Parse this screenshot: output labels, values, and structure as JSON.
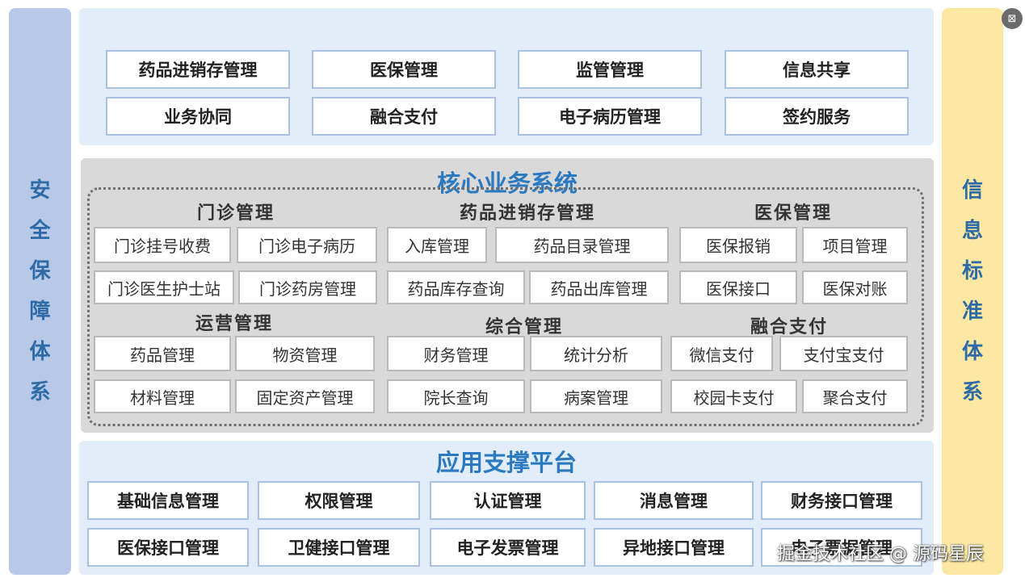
{
  "left_label": [
    "安",
    "全",
    "保",
    "障",
    "体",
    "系"
  ],
  "right_label": [
    "信",
    "息",
    "标",
    "准",
    "体",
    "系"
  ],
  "top_modules": [
    "药品进销存管理",
    "医保管理",
    "监管管理",
    "信息共享",
    "业务协同",
    "融合支付",
    "电子病历管理",
    "签约服务"
  ],
  "core": {
    "title": "核心业务系统",
    "groups": [
      {
        "name": "门诊管理",
        "items": [
          "门诊挂号收费",
          "门诊电子病历",
          "门诊医生护士站",
          "门诊药房管理"
        ]
      },
      {
        "name": "药品进销存管理",
        "items": [
          "入库管理",
          "药品目录管理",
          "药品库存查询",
          "药品出库管理"
        ]
      },
      {
        "name": "医保管理",
        "items": [
          "医保报销",
          "项目管理",
          "医保接口",
          "医保对账"
        ]
      },
      {
        "name": "运营管理",
        "items": [
          "药品管理",
          "物资管理",
          "材料管理",
          "固定资产管理"
        ]
      },
      {
        "name": "综合管理",
        "items": [
          "财务管理",
          "统计分析",
          "院长查询",
          "病案管理"
        ]
      },
      {
        "name": "融合支付",
        "items": [
          "微信支付",
          "支付宝支付",
          "校园卡支付",
          "聚合支付"
        ]
      }
    ]
  },
  "platform": {
    "title": "应用支撑平台",
    "items": [
      "基础信息管理",
      "权限管理",
      "认证管理",
      "消息管理",
      "财务接口管理",
      "医保接口管理",
      "卫健接口管理",
      "电子发票管理",
      "异地接口管理",
      "电子票据管理"
    ]
  },
  "watermark": "掘金技术社区 @ 源码星辰",
  "colors": {
    "title_blue": "#2b79bf",
    "side_blue": "#b7c9e6",
    "side_yellow": "#fce8a2",
    "panel_blue": "#e2edf9",
    "core_gray": "#d9d9d9"
  }
}
